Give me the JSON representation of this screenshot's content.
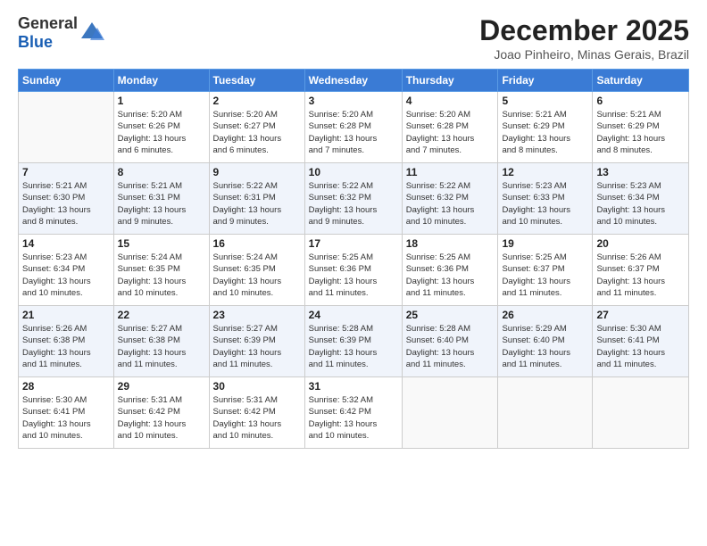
{
  "header": {
    "logo_general": "General",
    "logo_blue": "Blue",
    "month_title": "December 2025",
    "location": "Joao Pinheiro, Minas Gerais, Brazil"
  },
  "days_of_week": [
    "Sunday",
    "Monday",
    "Tuesday",
    "Wednesday",
    "Thursday",
    "Friday",
    "Saturday"
  ],
  "weeks": [
    [
      {
        "day": "",
        "info": ""
      },
      {
        "day": "1",
        "info": "Sunrise: 5:20 AM\nSunset: 6:26 PM\nDaylight: 13 hours\nand 6 minutes."
      },
      {
        "day": "2",
        "info": "Sunrise: 5:20 AM\nSunset: 6:27 PM\nDaylight: 13 hours\nand 6 minutes."
      },
      {
        "day": "3",
        "info": "Sunrise: 5:20 AM\nSunset: 6:28 PM\nDaylight: 13 hours\nand 7 minutes."
      },
      {
        "day": "4",
        "info": "Sunrise: 5:20 AM\nSunset: 6:28 PM\nDaylight: 13 hours\nand 7 minutes."
      },
      {
        "day": "5",
        "info": "Sunrise: 5:21 AM\nSunset: 6:29 PM\nDaylight: 13 hours\nand 8 minutes."
      },
      {
        "day": "6",
        "info": "Sunrise: 5:21 AM\nSunset: 6:29 PM\nDaylight: 13 hours\nand 8 minutes."
      }
    ],
    [
      {
        "day": "7",
        "info": "Sunrise: 5:21 AM\nSunset: 6:30 PM\nDaylight: 13 hours\nand 8 minutes."
      },
      {
        "day": "8",
        "info": "Sunrise: 5:21 AM\nSunset: 6:31 PM\nDaylight: 13 hours\nand 9 minutes."
      },
      {
        "day": "9",
        "info": "Sunrise: 5:22 AM\nSunset: 6:31 PM\nDaylight: 13 hours\nand 9 minutes."
      },
      {
        "day": "10",
        "info": "Sunrise: 5:22 AM\nSunset: 6:32 PM\nDaylight: 13 hours\nand 9 minutes."
      },
      {
        "day": "11",
        "info": "Sunrise: 5:22 AM\nSunset: 6:32 PM\nDaylight: 13 hours\nand 10 minutes."
      },
      {
        "day": "12",
        "info": "Sunrise: 5:23 AM\nSunset: 6:33 PM\nDaylight: 13 hours\nand 10 minutes."
      },
      {
        "day": "13",
        "info": "Sunrise: 5:23 AM\nSunset: 6:34 PM\nDaylight: 13 hours\nand 10 minutes."
      }
    ],
    [
      {
        "day": "14",
        "info": "Sunrise: 5:23 AM\nSunset: 6:34 PM\nDaylight: 13 hours\nand 10 minutes."
      },
      {
        "day": "15",
        "info": "Sunrise: 5:24 AM\nSunset: 6:35 PM\nDaylight: 13 hours\nand 10 minutes."
      },
      {
        "day": "16",
        "info": "Sunrise: 5:24 AM\nSunset: 6:35 PM\nDaylight: 13 hours\nand 10 minutes."
      },
      {
        "day": "17",
        "info": "Sunrise: 5:25 AM\nSunset: 6:36 PM\nDaylight: 13 hours\nand 11 minutes."
      },
      {
        "day": "18",
        "info": "Sunrise: 5:25 AM\nSunset: 6:36 PM\nDaylight: 13 hours\nand 11 minutes."
      },
      {
        "day": "19",
        "info": "Sunrise: 5:25 AM\nSunset: 6:37 PM\nDaylight: 13 hours\nand 11 minutes."
      },
      {
        "day": "20",
        "info": "Sunrise: 5:26 AM\nSunset: 6:37 PM\nDaylight: 13 hours\nand 11 minutes."
      }
    ],
    [
      {
        "day": "21",
        "info": "Sunrise: 5:26 AM\nSunset: 6:38 PM\nDaylight: 13 hours\nand 11 minutes."
      },
      {
        "day": "22",
        "info": "Sunrise: 5:27 AM\nSunset: 6:38 PM\nDaylight: 13 hours\nand 11 minutes."
      },
      {
        "day": "23",
        "info": "Sunrise: 5:27 AM\nSunset: 6:39 PM\nDaylight: 13 hours\nand 11 minutes."
      },
      {
        "day": "24",
        "info": "Sunrise: 5:28 AM\nSunset: 6:39 PM\nDaylight: 13 hours\nand 11 minutes."
      },
      {
        "day": "25",
        "info": "Sunrise: 5:28 AM\nSunset: 6:40 PM\nDaylight: 13 hours\nand 11 minutes."
      },
      {
        "day": "26",
        "info": "Sunrise: 5:29 AM\nSunset: 6:40 PM\nDaylight: 13 hours\nand 11 minutes."
      },
      {
        "day": "27",
        "info": "Sunrise: 5:30 AM\nSunset: 6:41 PM\nDaylight: 13 hours\nand 11 minutes."
      }
    ],
    [
      {
        "day": "28",
        "info": "Sunrise: 5:30 AM\nSunset: 6:41 PM\nDaylight: 13 hours\nand 10 minutes."
      },
      {
        "day": "29",
        "info": "Sunrise: 5:31 AM\nSunset: 6:42 PM\nDaylight: 13 hours\nand 10 minutes."
      },
      {
        "day": "30",
        "info": "Sunrise: 5:31 AM\nSunset: 6:42 PM\nDaylight: 13 hours\nand 10 minutes."
      },
      {
        "day": "31",
        "info": "Sunrise: 5:32 AM\nSunset: 6:42 PM\nDaylight: 13 hours\nand 10 minutes."
      },
      {
        "day": "",
        "info": ""
      },
      {
        "day": "",
        "info": ""
      },
      {
        "day": "",
        "info": ""
      }
    ]
  ]
}
